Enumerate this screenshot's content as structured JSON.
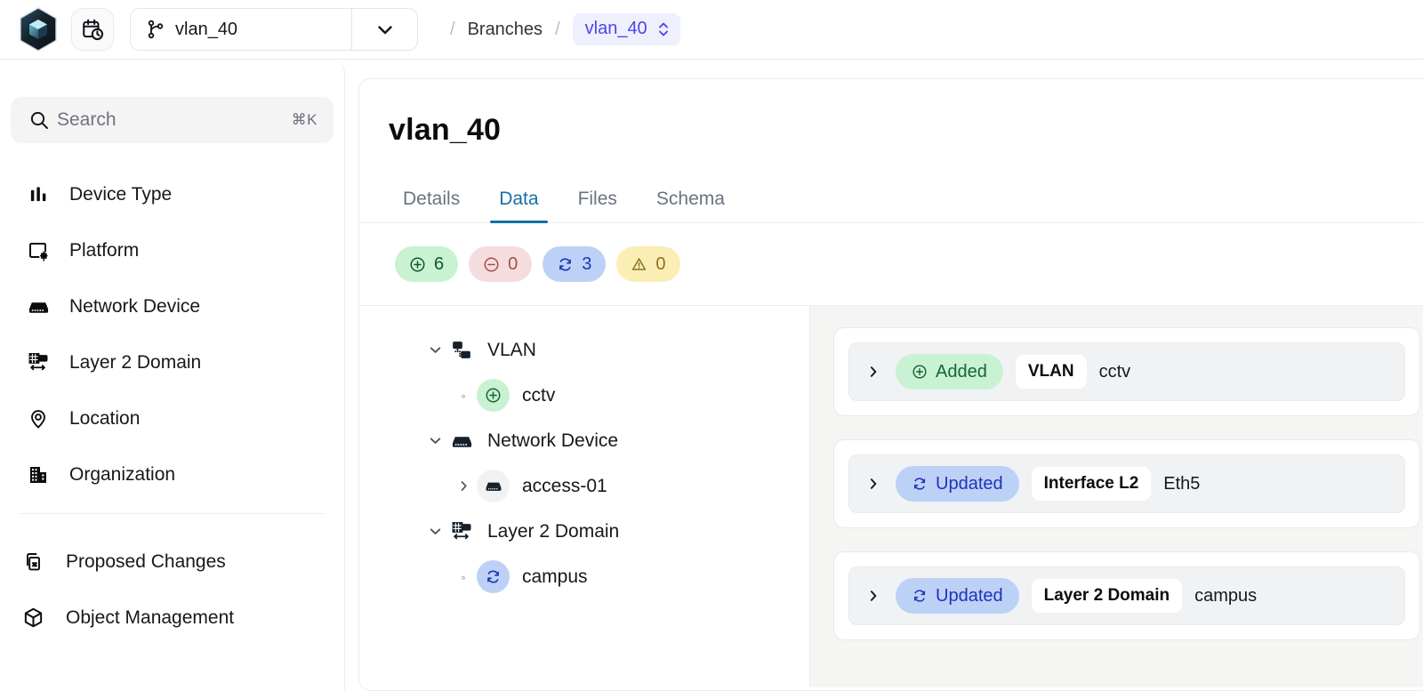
{
  "header": {
    "logo_icon": "infrahub-hexagon-logo",
    "calendar_button_icon": "calendar-clock-icon",
    "branch_selector": {
      "icon": "git-branch-icon",
      "value": "vlan_40",
      "caret_icon": "chevron-down-icon"
    },
    "breadcrumb": {
      "sep": "/",
      "items": [
        "Branches"
      ],
      "current": "vlan_40",
      "current_icon": "chevron-up-down-icon"
    }
  },
  "sidebar": {
    "search": {
      "icon": "search-icon",
      "placeholder": "Search",
      "shortcut": "⌘K"
    },
    "items": [
      {
        "label": "Device Type",
        "icon": "bar-chart-icon"
      },
      {
        "label": "Platform",
        "icon": "window-settings-icon"
      },
      {
        "label": "Network Device",
        "icon": "server-icon"
      },
      {
        "label": "Layer 2 Domain",
        "icon": "layer2-domain-icon"
      },
      {
        "label": "Location",
        "icon": "location-pin-icon"
      },
      {
        "label": "Organization",
        "icon": "building-icon"
      }
    ],
    "lower_items": [
      {
        "label": "Proposed Changes",
        "icon": "proposed-changes-icon"
      },
      {
        "label": "Object Management",
        "icon": "cube-icon"
      }
    ]
  },
  "main": {
    "title": "vlan_40",
    "tabs": [
      {
        "label": "Details",
        "active": false
      },
      {
        "label": "Data",
        "active": true
      },
      {
        "label": "Files",
        "active": false
      },
      {
        "label": "Schema",
        "active": false
      }
    ],
    "summary_pills": [
      {
        "kind": "added",
        "icon": "plus-circle-icon",
        "count": "6",
        "color": "#c9f2d2"
      },
      {
        "kind": "removed",
        "icon": "minus-circle-icon",
        "count": "0",
        "color": "#f6dddd"
      },
      {
        "kind": "updated",
        "icon": "refresh-icon",
        "count": "3",
        "color": "#bdd1f7"
      },
      {
        "kind": "warning",
        "icon": "warning-triangle-icon",
        "count": "0",
        "color": "#fbeeb4"
      }
    ],
    "tree": [
      {
        "level": 0,
        "label": "VLAN",
        "chevron": "chevron-down-icon",
        "icon": "vlan-icon",
        "state": null
      },
      {
        "level": 1,
        "label": "cctv",
        "chevron": "dot",
        "icon": "plus-circle-icon",
        "state": "added"
      },
      {
        "level": 0,
        "label": "Network Device",
        "chevron": "chevron-down-icon",
        "icon": "server-icon",
        "state": null
      },
      {
        "level": 1,
        "label": "access-01",
        "chevron": "chevron-right-icon",
        "icon": "server-icon",
        "state": "neutral"
      },
      {
        "level": 0,
        "label": "Layer 2 Domain",
        "chevron": "chevron-down-icon",
        "icon": "layer2-domain-icon",
        "state": null
      },
      {
        "level": 1,
        "label": "campus",
        "chevron": "dot",
        "icon": "refresh-icon",
        "state": "updated"
      }
    ],
    "diff_cards": [
      {
        "chevron": "chevron-right-icon",
        "state": "Added",
        "state_kind": "added",
        "state_icon": "plus-circle-icon",
        "kind": "VLAN",
        "name": "cctv"
      },
      {
        "chevron": "chevron-right-icon",
        "state": "Updated",
        "state_kind": "updated",
        "state_icon": "refresh-icon",
        "kind": "Interface L2",
        "name": "Eth5"
      },
      {
        "chevron": "chevron-right-icon",
        "state": "Updated",
        "state_kind": "updated",
        "state_icon": "refresh-icon",
        "kind": "Layer 2 Domain",
        "name": "campus"
      }
    ]
  },
  "colors": {
    "accent": "#1570a6",
    "brand_purple": "#4f46e5",
    "added": "#c9f2d2",
    "removed": "#f6dddd",
    "updated": "#bdd1f7",
    "warning": "#fbeeb4",
    "panel_bg": "#f5f5f4"
  }
}
